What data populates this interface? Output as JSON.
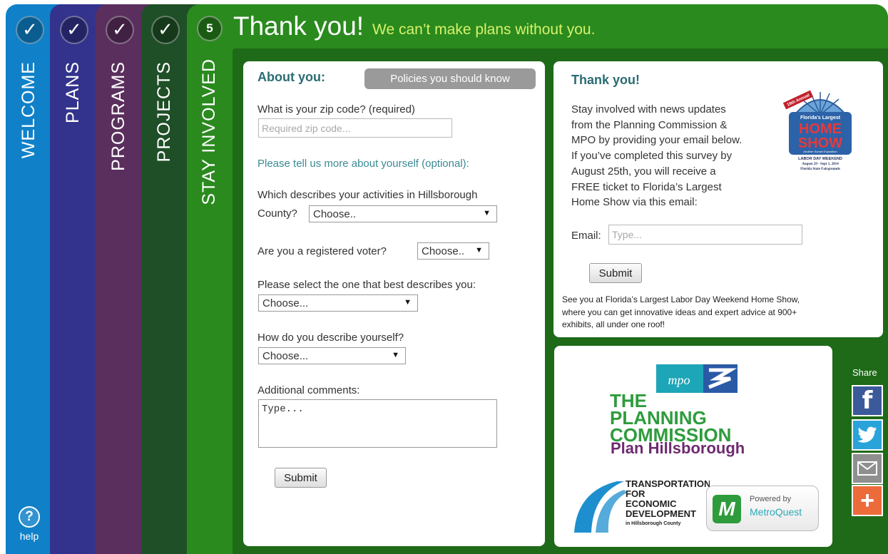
{
  "nav": {
    "tabs": [
      {
        "label": "WELCOME",
        "check": "✓"
      },
      {
        "label": "PLANS",
        "check": "✓"
      },
      {
        "label": "PROGRAMS",
        "check": "✓"
      },
      {
        "label": "PROJECTS",
        "check": "✓"
      },
      {
        "label": "STAY INVOLVED",
        "step": "5"
      }
    ],
    "help": {
      "icon": "?",
      "label": "help"
    }
  },
  "header": {
    "title": "Thank you!",
    "subtitle": "We can’t make plans without you."
  },
  "about": {
    "title": "About you:",
    "policies_button": "Policies you should know",
    "zip_label": "What is your zip code? (required)",
    "zip_placeholder": "Required zip code...",
    "optional_label": "Please tell us more about yourself (optional):",
    "activities_label_1": "Which describes your activities in Hillsborough",
    "activities_label_2": "County?",
    "activities_value": "Choose..",
    "voter_label": "Are you a registered voter?",
    "voter_value": "Choose..",
    "best_label": "Please select the one that best describes you:",
    "best_value": "Choose...",
    "describe_label": "How do you describe yourself?",
    "describe_value": "Choose...",
    "comments_label": "Additional comments:",
    "comments_placeholder": "Type...",
    "submit": "Submit"
  },
  "thanks": {
    "title": "Thank you!",
    "lines": [
      "Stay involved with news updates",
      "from the Planning Commission &",
      "MPO by providing your email below.",
      "If you’ve completed this survey by",
      "August 25th, you will receive a",
      "FREE ticket to Florida’s Largest",
      "Home Show via this email:"
    ],
    "email_label": "Email:",
    "email_placeholder": "Type...",
    "submit": "Submit",
    "footer_lines": [
      "See you at Florida’s Largest Labor Day Weekend Home Show,",
      "where you can get innovative ideas and expert advice at 900+",
      "exhibits, all under one roof!"
    ],
    "homeshow": {
      "annual": "19th Annual",
      "top": "Florida's Largest",
      "main1": "HOME",
      "main2": "SHOW",
      "tag": "Another Sunset Exposition",
      "weekend": "LABOR DAY WEEKEND",
      "dates": "August 29 - Sept 1, 2014",
      "place": "Florida State Fairgrounds"
    }
  },
  "logos": {
    "mpo": "mpo",
    "the": "THE",
    "planning": "PLANNING",
    "commission": "COMMISSION",
    "plan_hillsborough": "Plan Hillsborough",
    "ted_lines": [
      "TRANSPORTATION",
      "FOR",
      "ECONOMIC",
      "DEVELOPMENT",
      "in Hillsborough County"
    ],
    "metroquest_powered": "Powered by",
    "metroquest_name": "MetroQuest"
  },
  "share": {
    "label": "Share",
    "facebook": "f",
    "plus": "+"
  },
  "colors": {
    "welcome": "#1081c8",
    "plans": "#33338d",
    "programs": "#5a2f5e",
    "projects": "#1f4f27",
    "stay_involved": "#2a8a1e",
    "accent_text": "#d6f26b",
    "heading": "#2b6c73"
  }
}
